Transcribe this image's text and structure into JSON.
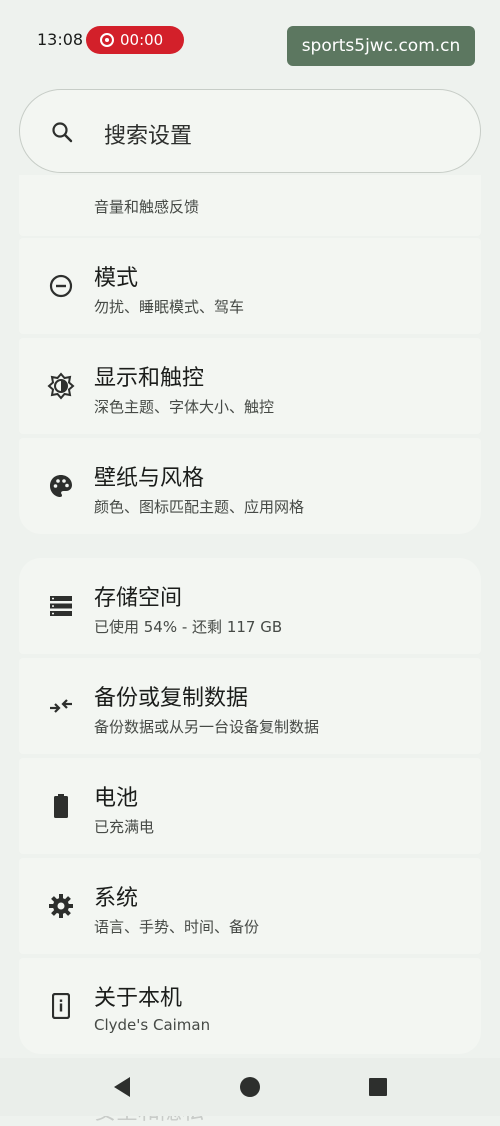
{
  "status": {
    "time": "13:08",
    "recording": "00:00"
  },
  "watermark": "sports5jwc.com.cn",
  "search": {
    "placeholder": "搜索设置"
  },
  "partial_item": {
    "subtitle": "音量和触感反馈"
  },
  "group1": [
    {
      "icon": "do-not-disturb-icon",
      "title": "模式",
      "subtitle": "勿扰、睡眠模式、驾车"
    },
    {
      "icon": "display-brightness-icon",
      "title": "显示和触控",
      "subtitle": "深色主题、字体大小、触控"
    },
    {
      "icon": "palette-icon",
      "title": "壁纸与风格",
      "subtitle": "颜色、图标匹配主题、应用网格"
    }
  ],
  "group2": [
    {
      "icon": "storage-icon",
      "title": "存储空间",
      "subtitle": "已使用 54% - 还剩 117 GB"
    },
    {
      "icon": "backup-transfer-icon",
      "title": "备份或复制数据",
      "subtitle": "备份数据或从另一台设备复制数据"
    },
    {
      "icon": "battery-icon",
      "title": "电池",
      "subtitle": "已充满电"
    },
    {
      "icon": "gear-icon",
      "title": "系统",
      "subtitle": "语言、手势、时间、备份"
    },
    {
      "icon": "device-info-icon",
      "title": "关于本机",
      "subtitle": "Clyde's Caiman"
    }
  ],
  "below_nav_text": "安全和隐私"
}
